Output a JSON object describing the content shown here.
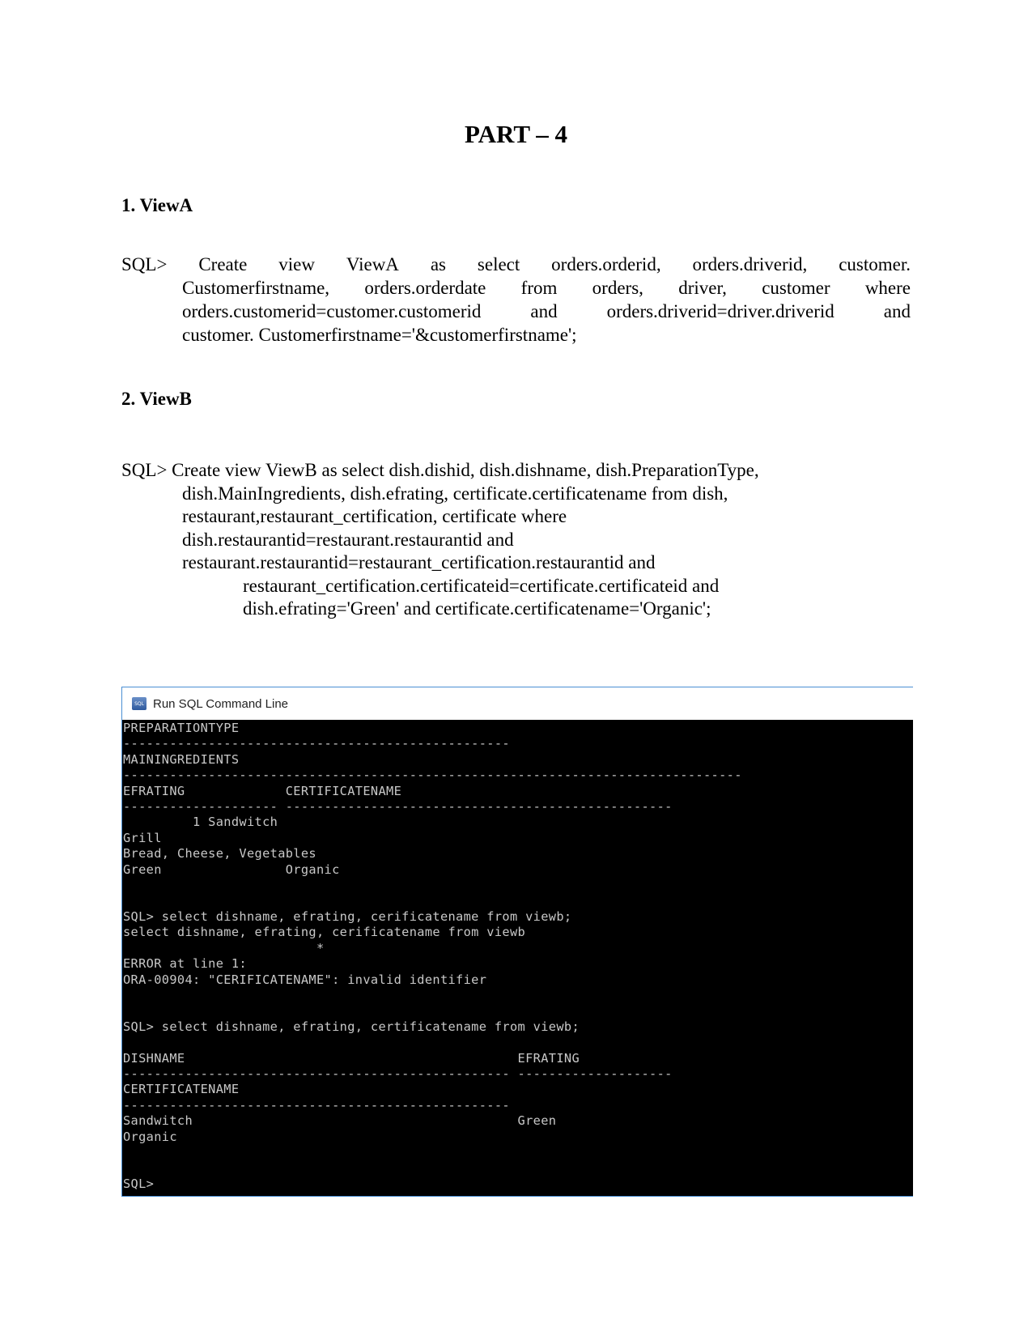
{
  "title": "PART – 4",
  "sections": [
    {
      "heading": "1. ViewA",
      "sql_lines": [
        [
          "SQL>",
          "Create",
          "view",
          "ViewA",
          "as",
          "select",
          "orders.orderid,",
          "orders.driverid,",
          "customer."
        ],
        [
          "Customerfirstname,",
          "orders.orderdate",
          "from",
          "orders,",
          "driver,",
          "customer",
          "where"
        ],
        [
          "orders.customerid=customer.customerid",
          "and",
          "orders.driverid=driver.driverid",
          "and"
        ],
        "customer. Customerfirstname='&customerfirstname';"
      ]
    },
    {
      "heading": "2. ViewB",
      "sql_lines": [
        "SQL> Create view ViewB as select dish.dishid, dish.dishname, dish.PreparationType,",
        "dish.MainIngredients, dish.efrating, certificate.certificatename from dish,",
        "restaurant,restaurant_certification, certificate where",
        "dish.restaurantid=restaurant.restaurantid and",
        "restaurant.restaurantid=restaurant_certification.restaurantid and",
        "restaurant_certification.certificateid=certificate.certificateid and",
        "dish.efrating='Green' and certificate.certificatename='Organic';"
      ]
    }
  ],
  "window": {
    "title": "Run SQL Command Line",
    "icon": "sql-app-icon",
    "console_lines": [
      "PREPARATIONTYPE",
      "--------------------------------------------------",
      "MAININGREDIENTS",
      "--------------------------------------------------------------------------------",
      "EFRATING             CERTIFICATENAME",
      "-------------------- --------------------------------------------------",
      "         1 Sandwitch",
      "Grill",
      "Bread, Cheese, Vegetables",
      "Green                Organic",
      "",
      "",
      "SQL> select dishname, efrating, cerificatename from viewb;",
      "select dishname, efrating, cerificatename from viewb",
      "                         *",
      "ERROR at line 1:",
      "ORA-00904: \"CERIFICATENAME\": invalid identifier",
      "",
      "",
      "SQL> select dishname, efrating, certificatename from viewb;",
      "",
      "DISHNAME                                           EFRATING",
      "-------------------------------------------------- --------------------",
      "CERTIFICATENAME",
      "--------------------------------------------------",
      "Sandwitch                                          Green",
      "Organic",
      "",
      "",
      "SQL>"
    ]
  }
}
